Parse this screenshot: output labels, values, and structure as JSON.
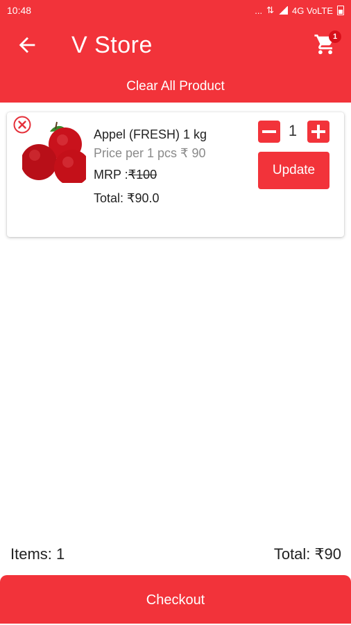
{
  "status_bar": {
    "time": "10:48",
    "network": "4G VoLTE",
    "dots": "..."
  },
  "app_bar": {
    "title": "V Store",
    "cart_count": "1"
  },
  "clear_all_label": "Clear All Product",
  "cart_item": {
    "name": "Appel (FRESH) 1 kg",
    "price_per": "Price per 1 pcs ₹ 90",
    "mrp_label": "MRP :",
    "mrp_value": "₹100",
    "total": "Total:  ₹90.0",
    "quantity": "1",
    "update_label": "Update"
  },
  "summary": {
    "items": "Items: 1",
    "total": "Total: ₹90"
  },
  "checkout_label": "Checkout",
  "colors": {
    "primary": "#f2333a",
    "badge": "#d8101a"
  },
  "icons": [
    "back-arrow-icon",
    "cart-icon",
    "remove-icon",
    "minus-icon",
    "plus-icon"
  ]
}
